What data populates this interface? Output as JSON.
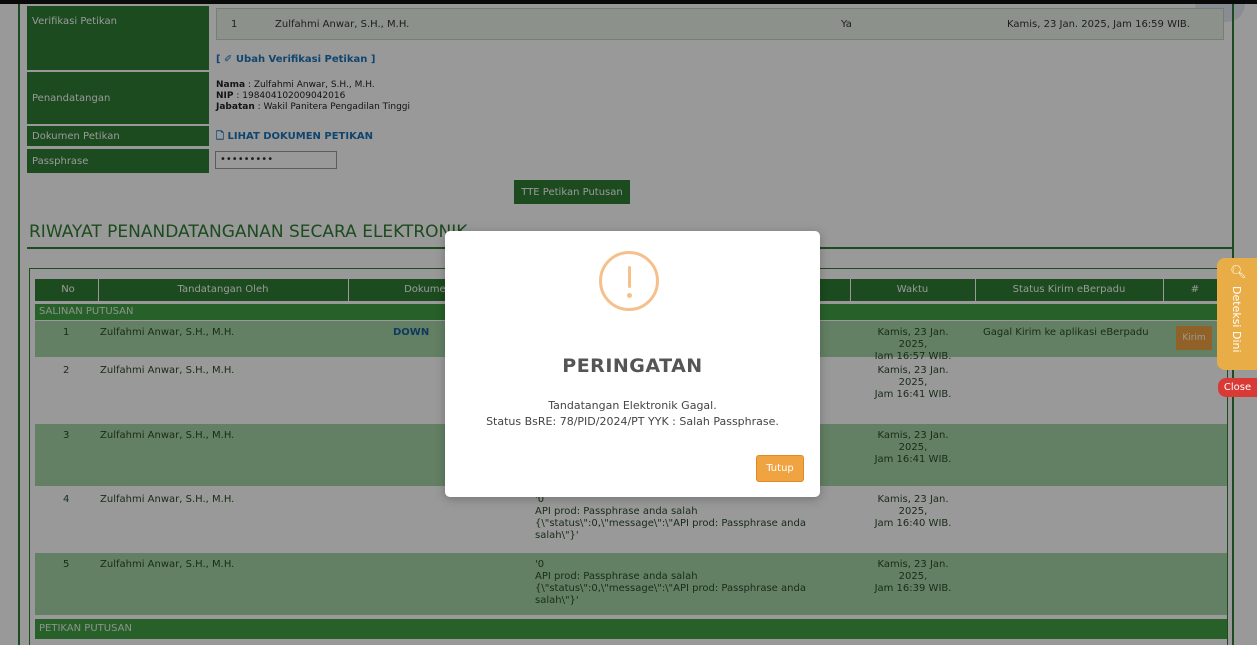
{
  "form": {
    "verifikasi_label": "Verifikasi Petikan",
    "verif_row": {
      "no": "1",
      "name": "Zulfahmi Anwar, S.H., M.H.",
      "status": "Ya",
      "time": "Kamis, 23 Jan. 2025, Jam 16:59 WIB."
    },
    "ubah_link": "[ ✐ Ubah Verifikasi Petikan ]",
    "penandatangan_label": "Penandatangan",
    "nama_label": "Nama",
    "nama_value": " : Zulfahmi Anwar, S.H., M.H.",
    "nip_label": "NIP",
    "nip_value": " : 198404102009042016",
    "jabatan_label": "Jabatan",
    "jabatan_value": " : Wakil Panitera Pengadilan Tinggi",
    "dokumen_label": "Dokumen Petikan",
    "lihat_link": "🗋 LIHAT DOKUMEN PETIKAN",
    "passphrase_label": "Passphrase",
    "passphrase_value": "•••••••••",
    "tte_button": "TTE Petikan Putusan"
  },
  "riwayat": {
    "title": "RIWAYAT PENANDATANGANAN SECARA ELEKTRONIK",
    "headers": {
      "no": "No",
      "by": "Tandatangan Oleh",
      "dokumen": "Dokumen",
      "waktu": "Waktu",
      "status": "Status Kirim eBerpadu",
      "aksi": "#"
    },
    "section_salinan": "SALINAN PUTUSAN",
    "section_petikan": "PETIKAN PUTUSAN",
    "rows": [
      {
        "no": "1",
        "by": "Zulfahmi Anwar, S.H., M.H.",
        "dokumen": "DOWN",
        "time": "Kamis, 23 Jan. 2025,\nJam 16:57 WIB.",
        "status": "Gagal Kirim ke aplikasi eBerpadu",
        "action": "Kirim"
      },
      {
        "no": "2",
        "by": "Zulfahmi Anwar, S.H., M.H.",
        "time": "Kamis, 23 Jan. 2025,\nJam 16:41 WIB."
      },
      {
        "no": "3",
        "by": "Zulfahmi Anwar, S.H., M.H.",
        "time": "Kamis, 23 Jan. 2025,\nJam 16:41 WIB."
      },
      {
        "no": "4",
        "by": "Zulfahmi Anwar, S.H., M.H.",
        "message": "'0\nAPI prod: Passphrase anda salah\n{\\\"status\\\":0,\\\"message\\\":\\\"API prod: Passphrase anda salah\\\"}'",
        "time": "Kamis, 23 Jan. 2025,\nJam 16:40 WIB."
      },
      {
        "no": "5",
        "by": "Zulfahmi Anwar, S.H., M.H.",
        "message": "'0\nAPI prod: Passphrase anda salah\n{\\\"status\\\":0,\\\"message\\\":\\\"API prod: Passphrase anda salah\\\"}'",
        "time": "Kamis, 23 Jan. 2025,\nJam 16:39 WIB."
      }
    ]
  },
  "side": {
    "deteksi_label": "Deteksi Dini",
    "close_label": "Close",
    "magnifier_icon": "search-icon"
  },
  "modal": {
    "icon": "warning-icon",
    "title": "PERINGATAN",
    "line1": "Tandatangan Elektronik Gagal.",
    "line2": "Status BsRE: 78/PID/2024/PT YYK : Salah Passphrase.",
    "button": "Tutup"
  },
  "colors": {
    "primary_green": "#2e7d32",
    "row_green": "#a5d6a7",
    "accent_orange": "#f0a441",
    "close_red": "#d93a36"
  }
}
